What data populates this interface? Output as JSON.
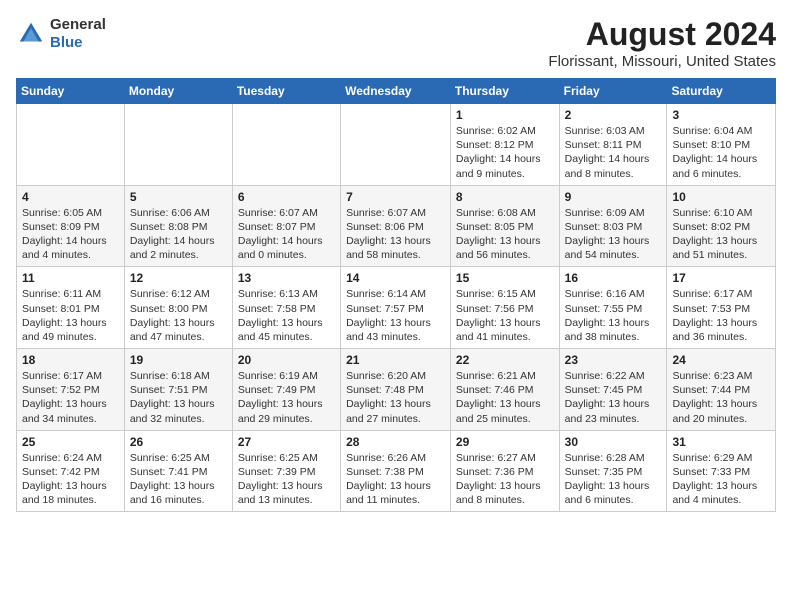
{
  "logo": {
    "general": "General",
    "blue": "Blue"
  },
  "title": "August 2024",
  "subtitle": "Florissant, Missouri, United States",
  "days_header": [
    "Sunday",
    "Monday",
    "Tuesday",
    "Wednesday",
    "Thursday",
    "Friday",
    "Saturday"
  ],
  "weeks": [
    [
      {
        "day": "",
        "info": ""
      },
      {
        "day": "",
        "info": ""
      },
      {
        "day": "",
        "info": ""
      },
      {
        "day": "",
        "info": ""
      },
      {
        "day": "1",
        "info": "Sunrise: 6:02 AM\nSunset: 8:12 PM\nDaylight: 14 hours\nand 9 minutes."
      },
      {
        "day": "2",
        "info": "Sunrise: 6:03 AM\nSunset: 8:11 PM\nDaylight: 14 hours\nand 8 minutes."
      },
      {
        "day": "3",
        "info": "Sunrise: 6:04 AM\nSunset: 8:10 PM\nDaylight: 14 hours\nand 6 minutes."
      }
    ],
    [
      {
        "day": "4",
        "info": "Sunrise: 6:05 AM\nSunset: 8:09 PM\nDaylight: 14 hours\nand 4 minutes."
      },
      {
        "day": "5",
        "info": "Sunrise: 6:06 AM\nSunset: 8:08 PM\nDaylight: 14 hours\nand 2 minutes."
      },
      {
        "day": "6",
        "info": "Sunrise: 6:07 AM\nSunset: 8:07 PM\nDaylight: 14 hours\nand 0 minutes."
      },
      {
        "day": "7",
        "info": "Sunrise: 6:07 AM\nSunset: 8:06 PM\nDaylight: 13 hours\nand 58 minutes."
      },
      {
        "day": "8",
        "info": "Sunrise: 6:08 AM\nSunset: 8:05 PM\nDaylight: 13 hours\nand 56 minutes."
      },
      {
        "day": "9",
        "info": "Sunrise: 6:09 AM\nSunset: 8:03 PM\nDaylight: 13 hours\nand 54 minutes."
      },
      {
        "day": "10",
        "info": "Sunrise: 6:10 AM\nSunset: 8:02 PM\nDaylight: 13 hours\nand 51 minutes."
      }
    ],
    [
      {
        "day": "11",
        "info": "Sunrise: 6:11 AM\nSunset: 8:01 PM\nDaylight: 13 hours\nand 49 minutes."
      },
      {
        "day": "12",
        "info": "Sunrise: 6:12 AM\nSunset: 8:00 PM\nDaylight: 13 hours\nand 47 minutes."
      },
      {
        "day": "13",
        "info": "Sunrise: 6:13 AM\nSunset: 7:58 PM\nDaylight: 13 hours\nand 45 minutes."
      },
      {
        "day": "14",
        "info": "Sunrise: 6:14 AM\nSunset: 7:57 PM\nDaylight: 13 hours\nand 43 minutes."
      },
      {
        "day": "15",
        "info": "Sunrise: 6:15 AM\nSunset: 7:56 PM\nDaylight: 13 hours\nand 41 minutes."
      },
      {
        "day": "16",
        "info": "Sunrise: 6:16 AM\nSunset: 7:55 PM\nDaylight: 13 hours\nand 38 minutes."
      },
      {
        "day": "17",
        "info": "Sunrise: 6:17 AM\nSunset: 7:53 PM\nDaylight: 13 hours\nand 36 minutes."
      }
    ],
    [
      {
        "day": "18",
        "info": "Sunrise: 6:17 AM\nSunset: 7:52 PM\nDaylight: 13 hours\nand 34 minutes."
      },
      {
        "day": "19",
        "info": "Sunrise: 6:18 AM\nSunset: 7:51 PM\nDaylight: 13 hours\nand 32 minutes."
      },
      {
        "day": "20",
        "info": "Sunrise: 6:19 AM\nSunset: 7:49 PM\nDaylight: 13 hours\nand 29 minutes."
      },
      {
        "day": "21",
        "info": "Sunrise: 6:20 AM\nSunset: 7:48 PM\nDaylight: 13 hours\nand 27 minutes."
      },
      {
        "day": "22",
        "info": "Sunrise: 6:21 AM\nSunset: 7:46 PM\nDaylight: 13 hours\nand 25 minutes."
      },
      {
        "day": "23",
        "info": "Sunrise: 6:22 AM\nSunset: 7:45 PM\nDaylight: 13 hours\nand 23 minutes."
      },
      {
        "day": "24",
        "info": "Sunrise: 6:23 AM\nSunset: 7:44 PM\nDaylight: 13 hours\nand 20 minutes."
      }
    ],
    [
      {
        "day": "25",
        "info": "Sunrise: 6:24 AM\nSunset: 7:42 PM\nDaylight: 13 hours\nand 18 minutes."
      },
      {
        "day": "26",
        "info": "Sunrise: 6:25 AM\nSunset: 7:41 PM\nDaylight: 13 hours\nand 16 minutes."
      },
      {
        "day": "27",
        "info": "Sunrise: 6:25 AM\nSunset: 7:39 PM\nDaylight: 13 hours\nand 13 minutes."
      },
      {
        "day": "28",
        "info": "Sunrise: 6:26 AM\nSunset: 7:38 PM\nDaylight: 13 hours\nand 11 minutes."
      },
      {
        "day": "29",
        "info": "Sunrise: 6:27 AM\nSunset: 7:36 PM\nDaylight: 13 hours\nand 8 minutes."
      },
      {
        "day": "30",
        "info": "Sunrise: 6:28 AM\nSunset: 7:35 PM\nDaylight: 13 hours\nand 6 minutes."
      },
      {
        "day": "31",
        "info": "Sunrise: 6:29 AM\nSunset: 7:33 PM\nDaylight: 13 hours\nand 4 minutes."
      }
    ]
  ]
}
